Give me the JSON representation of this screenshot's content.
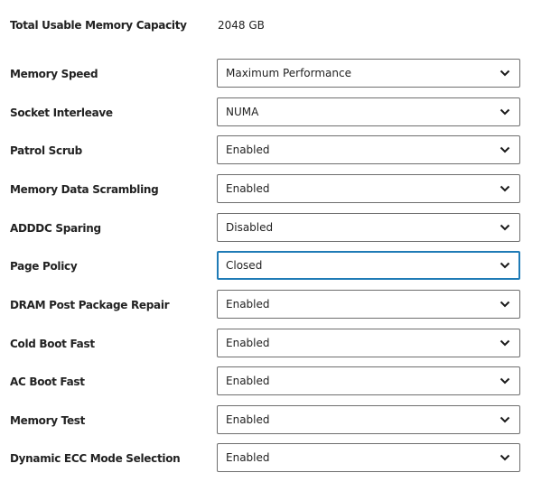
{
  "capacity": {
    "label": "Total Usable Memory Capacity",
    "value": "2048 GB"
  },
  "settings": [
    {
      "label": "Memory Speed",
      "value": "Maximum Performance",
      "focused": false
    },
    {
      "label": "Socket Interleave",
      "value": "NUMA",
      "focused": false
    },
    {
      "label": "Patrol Scrub",
      "value": "Enabled",
      "focused": false
    },
    {
      "label": "Memory Data Scrambling",
      "value": "Enabled",
      "focused": false
    },
    {
      "label": "ADDDC Sparing",
      "value": "Disabled",
      "focused": false
    },
    {
      "label": "Page Policy",
      "value": "Closed",
      "focused": true
    },
    {
      "label": "DRAM Post Package Repair",
      "value": "Enabled",
      "focused": false
    },
    {
      "label": "Cold Boot Fast",
      "value": "Enabled",
      "focused": false
    },
    {
      "label": "AC Boot Fast",
      "value": "Enabled",
      "focused": false
    },
    {
      "label": "Memory Test",
      "value": "Enabled",
      "focused": false
    },
    {
      "label": "Dynamic ECC Mode Selection",
      "value": "Enabled",
      "focused": false
    }
  ],
  "icons": {
    "dropdown": "chevron-down-icon"
  },
  "colors": {
    "focus_border": "#1f7bb6",
    "select_border": "#6e6e6e",
    "text": "#222222"
  }
}
